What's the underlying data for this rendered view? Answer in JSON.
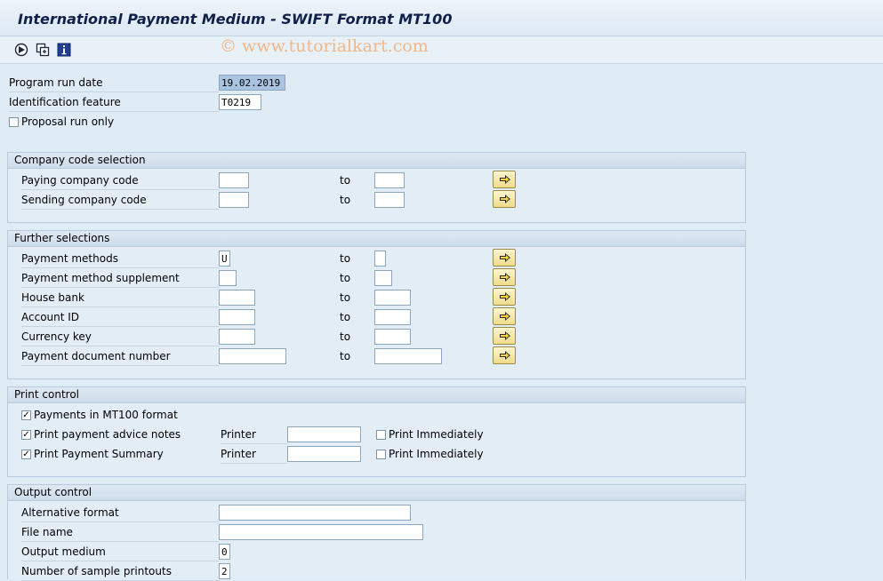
{
  "window": {
    "title": "International Payment Medium - SWIFT Format MT100"
  },
  "toolbar": {
    "icons": [
      "execute-icon",
      "get-variant-icon",
      "information-icon"
    ]
  },
  "watermark": "© www.tutorialkart.com",
  "fields": {
    "run_date": {
      "label": "Program run date",
      "value": "19.02.2019"
    },
    "identification": {
      "label": "Identification feature",
      "value": "T0219"
    },
    "proposal_run": {
      "label": "Proposal run only",
      "checked": false
    }
  },
  "company": {
    "title": "Company code selection",
    "to_label": "to",
    "rows": [
      {
        "label": "Paying company code",
        "from": "",
        "to": ""
      },
      {
        "label": "Sending company code",
        "from": "",
        "to": ""
      }
    ]
  },
  "further": {
    "title": "Further selections",
    "to_label": "to",
    "rows": [
      {
        "label": "Payment methods",
        "from": "U",
        "to": ""
      },
      {
        "label": "Payment method supplement",
        "from": "",
        "to": ""
      },
      {
        "label": "House bank",
        "from": "",
        "to": ""
      },
      {
        "label": "Account ID",
        "from": "",
        "to": ""
      },
      {
        "label": "Currency key",
        "from": "",
        "to": ""
      },
      {
        "label": "Payment document number",
        "from": "",
        "to": ""
      }
    ]
  },
  "print": {
    "title": "Print control",
    "printer_label": "Printer",
    "immediate_label": "Print Immediately",
    "rows": [
      {
        "label": "Payments in MT100 format",
        "checked": true
      },
      {
        "label": "Print payment advice notes",
        "checked": true,
        "printer": "",
        "immediately": false
      },
      {
        "label": "Print Payment Summary",
        "checked": true,
        "printer": "",
        "immediately": false
      }
    ]
  },
  "output": {
    "title": "Output control",
    "rows": [
      {
        "label": "Alternative format",
        "value": ""
      },
      {
        "label": "File name",
        "value": ""
      },
      {
        "label": "Output medium",
        "value": "0"
      },
      {
        "label": "Number of sample printouts",
        "value": "2"
      }
    ]
  },
  "colors": {
    "background": "#dfebf5",
    "group_header": "#d4e2ef",
    "button_yellow": "#f6e7a6",
    "title_text": "#10204a"
  }
}
